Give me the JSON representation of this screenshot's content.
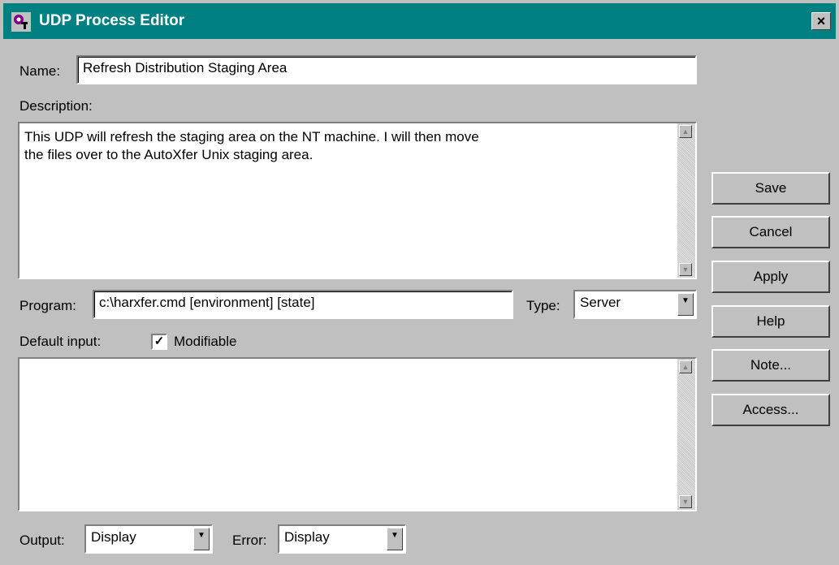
{
  "window": {
    "title": "UDP Process Editor",
    "close_glyph": "×"
  },
  "name": {
    "label": "Name:",
    "value": "Refresh Distribution Staging Area"
  },
  "description": {
    "label": "Description:",
    "value": "This UDP will refresh the staging area on the NT machine. I will then move\nthe files over to the AutoXfer Unix staging area."
  },
  "program": {
    "label": "Program:",
    "value": "c:\\harxfer.cmd [environment] [state]"
  },
  "type": {
    "label": "Type:",
    "value": "Server"
  },
  "default_input": {
    "label": "Default input:",
    "value": ""
  },
  "modifiable": {
    "label": "Modifiable",
    "checked": true
  },
  "output": {
    "label": "Output:",
    "value": "Display"
  },
  "error": {
    "label": "Error:",
    "value": "Display"
  },
  "buttons": {
    "save": "Save",
    "cancel": "Cancel",
    "apply": "Apply",
    "help": "Help",
    "note": "Note...",
    "access": "Access..."
  },
  "icons": {
    "app": "udp-process-icon",
    "close": "close-icon",
    "scroll_up": "scroll-up-icon",
    "scroll_down": "scroll-down-icon",
    "dropdown": "chevron-down-icon",
    "check": "checkmark-icon"
  },
  "colors": {
    "titlebar": "#008080",
    "face": "#c0c0c0"
  }
}
